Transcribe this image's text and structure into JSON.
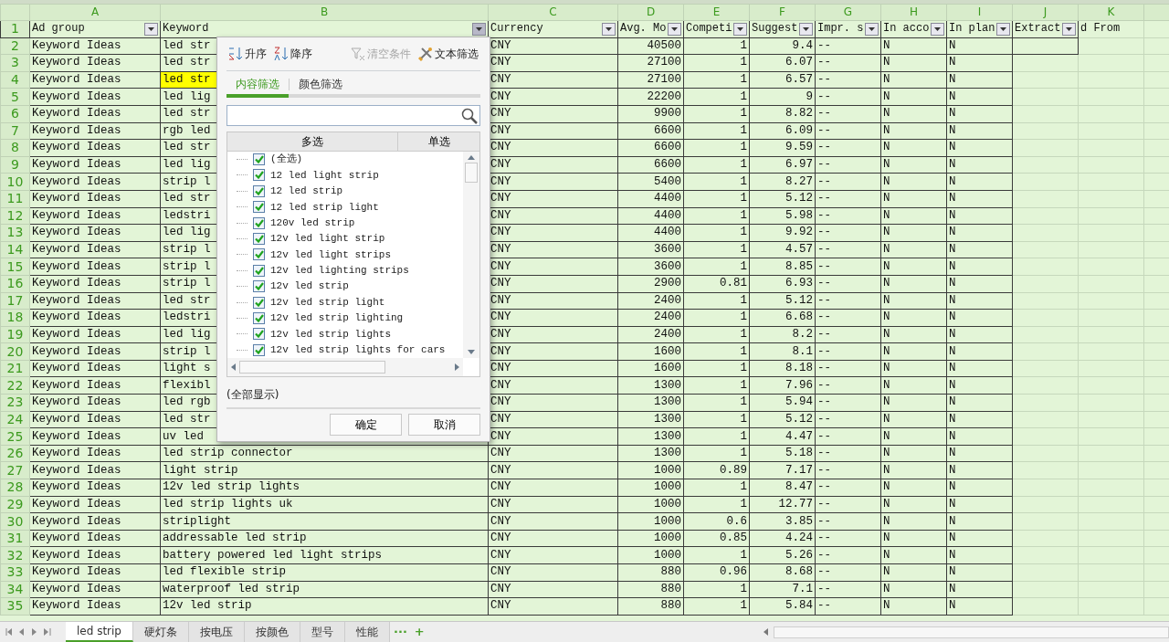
{
  "header_row_number": "1",
  "columns": [
    {
      "letter": "A",
      "header": "Ad group",
      "filter": true,
      "numeric": false,
      "open": false
    },
    {
      "letter": "B",
      "header": "Keyword",
      "filter": true,
      "numeric": false,
      "open": true
    },
    {
      "letter": "C",
      "header": "Currency",
      "filter": true,
      "numeric": false,
      "open": false
    },
    {
      "letter": "D",
      "header": "Avg. Mo",
      "filter": true,
      "numeric": true,
      "open": false
    },
    {
      "letter": "E",
      "header": "Competi",
      "filter": true,
      "numeric": true,
      "open": false
    },
    {
      "letter": "F",
      "header": "Suggest",
      "filter": true,
      "numeric": true,
      "open": false
    },
    {
      "letter": "G",
      "header": "Impr. s",
      "filter": true,
      "numeric": false,
      "open": false
    },
    {
      "letter": "H",
      "header": "In acco",
      "filter": true,
      "numeric": false,
      "open": false
    },
    {
      "letter": "I",
      "header": "In plan",
      "filter": true,
      "numeric": false,
      "open": false
    },
    {
      "letter": "J",
      "header": "Extract",
      "filter": true,
      "numeric": false,
      "open": false
    },
    {
      "letter": "K",
      "header": "d From",
      "filter": false
    }
  ],
  "rows": [
    {
      "number": "2",
      "cells": [
        "Keyword Ideas",
        "led str",
        "CNY",
        "40500",
        "1",
        "9.4",
        "--",
        "N",
        "N"
      ],
      "highlighted": false
    },
    {
      "number": "3",
      "cells": [
        "Keyword Ideas",
        "led str",
        "CNY",
        "27100",
        "1",
        "6.07",
        "--",
        "N",
        "N"
      ],
      "highlighted": false
    },
    {
      "number": "4",
      "cells": [
        "Keyword Ideas",
        "led str",
        "CNY",
        "27100",
        "1",
        "6.57",
        "--",
        "N",
        "N"
      ],
      "highlighted": true
    },
    {
      "number": "5",
      "cells": [
        "Keyword Ideas",
        "led lig",
        "CNY",
        "22200",
        "1",
        "9",
        "--",
        "N",
        "N"
      ],
      "highlighted": false
    },
    {
      "number": "6",
      "cells": [
        "Keyword Ideas",
        "led str",
        "CNY",
        "9900",
        "1",
        "8.82",
        "--",
        "N",
        "N"
      ],
      "highlighted": false
    },
    {
      "number": "7",
      "cells": [
        "Keyword Ideas",
        "rgb led",
        "CNY",
        "6600",
        "1",
        "6.09",
        "--",
        "N",
        "N"
      ],
      "highlighted": false
    },
    {
      "number": "8",
      "cells": [
        "Keyword Ideas",
        "led str",
        "CNY",
        "6600",
        "1",
        "9.59",
        "--",
        "N",
        "N"
      ],
      "highlighted": false
    },
    {
      "number": "9",
      "cells": [
        "Keyword Ideas",
        "led lig",
        "CNY",
        "6600",
        "1",
        "6.97",
        "--",
        "N",
        "N"
      ],
      "highlighted": false
    },
    {
      "number": "10",
      "cells": [
        "Keyword Ideas",
        "strip l",
        "CNY",
        "5400",
        "1",
        "8.27",
        "--",
        "N",
        "N"
      ],
      "highlighted": false
    },
    {
      "number": "11",
      "cells": [
        "Keyword Ideas",
        "led str",
        "CNY",
        "4400",
        "1",
        "5.12",
        "--",
        "N",
        "N"
      ],
      "highlighted": false
    },
    {
      "number": "12",
      "cells": [
        "Keyword Ideas",
        "ledstri",
        "CNY",
        "4400",
        "1",
        "5.98",
        "--",
        "N",
        "N"
      ],
      "highlighted": false
    },
    {
      "number": "13",
      "cells": [
        "Keyword Ideas",
        "led lig",
        "CNY",
        "4400",
        "1",
        "9.92",
        "--",
        "N",
        "N"
      ],
      "highlighted": false
    },
    {
      "number": "14",
      "cells": [
        "Keyword Ideas",
        "strip l",
        "CNY",
        "3600",
        "1",
        "4.57",
        "--",
        "N",
        "N"
      ],
      "highlighted": false
    },
    {
      "number": "15",
      "cells": [
        "Keyword Ideas",
        "strip l",
        "CNY",
        "3600",
        "1",
        "8.85",
        "--",
        "N",
        "N"
      ],
      "highlighted": false
    },
    {
      "number": "16",
      "cells": [
        "Keyword Ideas",
        "strip l",
        "CNY",
        "2900",
        "0.81",
        "6.93",
        "--",
        "N",
        "N"
      ],
      "highlighted": false
    },
    {
      "number": "17",
      "cells": [
        "Keyword Ideas",
        "led str",
        "CNY",
        "2400",
        "1",
        "5.12",
        "--",
        "N",
        "N"
      ],
      "highlighted": false
    },
    {
      "number": "18",
      "cells": [
        "Keyword Ideas",
        "ledstri",
        "CNY",
        "2400",
        "1",
        "6.68",
        "--",
        "N",
        "N"
      ],
      "highlighted": false
    },
    {
      "number": "19",
      "cells": [
        "Keyword Ideas",
        "led lig",
        "CNY",
        "2400",
        "1",
        "8.2",
        "--",
        "N",
        "N"
      ],
      "highlighted": false
    },
    {
      "number": "20",
      "cells": [
        "Keyword Ideas",
        "strip l",
        "CNY",
        "1600",
        "1",
        "8.1",
        "--",
        "N",
        "N"
      ],
      "highlighted": false
    },
    {
      "number": "21",
      "cells": [
        "Keyword Ideas",
        "light s",
        "CNY",
        "1600",
        "1",
        "8.18",
        "--",
        "N",
        "N"
      ],
      "highlighted": false
    },
    {
      "number": "22",
      "cells": [
        "Keyword Ideas",
        "flexibl",
        "CNY",
        "1300",
        "1",
        "7.96",
        "--",
        "N",
        "N"
      ],
      "highlighted": false
    },
    {
      "number": "23",
      "cells": [
        "Keyword Ideas",
        "led rgb",
        "CNY",
        "1300",
        "1",
        "5.94",
        "--",
        "N",
        "N"
      ],
      "highlighted": false
    },
    {
      "number": "24",
      "cells": [
        "Keyword Ideas",
        "led str",
        "CNY",
        "1300",
        "1",
        "5.12",
        "--",
        "N",
        "N"
      ],
      "highlighted": false
    },
    {
      "number": "25",
      "cells": [
        "Keyword Ideas",
        "uv led",
        "CNY",
        "1300",
        "1",
        "4.47",
        "--",
        "N",
        "N"
      ],
      "highlighted": false
    },
    {
      "number": "26",
      "cells": [
        "Keyword Ideas",
        "led strip connector",
        "CNY",
        "1300",
        "1",
        "5.18",
        "--",
        "N",
        "N"
      ],
      "highlighted": false
    },
    {
      "number": "27",
      "cells": [
        "Keyword Ideas",
        "light strip",
        "CNY",
        "1000",
        "0.89",
        "7.17",
        "--",
        "N",
        "N"
      ],
      "highlighted": false
    },
    {
      "number": "28",
      "cells": [
        "Keyword Ideas",
        "12v led strip lights",
        "CNY",
        "1000",
        "1",
        "8.47",
        "--",
        "N",
        "N"
      ],
      "highlighted": false
    },
    {
      "number": "29",
      "cells": [
        "Keyword Ideas",
        "led strip lights uk",
        "CNY",
        "1000",
        "1",
        "12.77",
        "--",
        "N",
        "N"
      ],
      "highlighted": false
    },
    {
      "number": "30",
      "cells": [
        "Keyword Ideas",
        "striplight",
        "CNY",
        "1000",
        "0.6",
        "3.85",
        "--",
        "N",
        "N"
      ],
      "highlighted": false
    },
    {
      "number": "31",
      "cells": [
        "Keyword Ideas",
        "addressable led strip",
        "CNY",
        "1000",
        "0.85",
        "4.24",
        "--",
        "N",
        "N"
      ],
      "highlighted": false
    },
    {
      "number": "32",
      "cells": [
        "Keyword Ideas",
        "battery powered led light strips",
        "CNY",
        "1000",
        "1",
        "5.26",
        "--",
        "N",
        "N"
      ],
      "highlighted": false
    },
    {
      "number": "33",
      "cells": [
        "Keyword Ideas",
        "led flexible strip",
        "CNY",
        "880",
        "0.96",
        "8.68",
        "--",
        "N",
        "N"
      ],
      "highlighted": false
    },
    {
      "number": "34",
      "cells": [
        "Keyword Ideas",
        "waterproof led strip",
        "CNY",
        "880",
        "1",
        "7.1",
        "--",
        "N",
        "N"
      ],
      "highlighted": false
    },
    {
      "number": "35",
      "cells": [
        "Keyword Ideas",
        "12v led strip",
        "CNY",
        "880",
        "1",
        "5.84",
        "--",
        "N",
        "N"
      ],
      "highlighted": false
    }
  ],
  "filter_popup": {
    "actions": [
      {
        "label": "升序",
        "kind": "asc",
        "disabled": false
      },
      {
        "label": "降序",
        "kind": "desc",
        "disabled": false
      },
      {
        "label": "清空条件",
        "kind": "clear",
        "disabled": true
      },
      {
        "label": "文本筛选",
        "kind": "text",
        "disabled": false
      }
    ],
    "tabs": [
      {
        "label": "内容筛选",
        "selected": true
      },
      {
        "label": "颜色筛选",
        "selected": false
      }
    ],
    "modes": [
      "多选",
      "单选"
    ],
    "items": [
      {
        "label": "(全选)",
        "checked": true
      },
      {
        "label": "12 led light strip",
        "checked": true
      },
      {
        "label": "12 led strip",
        "checked": true
      },
      {
        "label": "12 led strip light",
        "checked": true
      },
      {
        "label": "120v led strip",
        "checked": true
      },
      {
        "label": "12v led light strip",
        "checked": true
      },
      {
        "label": "12v led light strips",
        "checked": true
      },
      {
        "label": "12v led lighting strips",
        "checked": true
      },
      {
        "label": "12v led strip",
        "checked": true
      },
      {
        "label": "12v led strip light",
        "checked": true
      },
      {
        "label": "12v led strip lighting",
        "checked": true
      },
      {
        "label": "12v led strip lights",
        "checked": true
      },
      {
        "label": "12v led strip lights for cars",
        "checked": true
      }
    ],
    "note": "(全部显示)",
    "buttons": [
      "确定",
      "取消"
    ]
  },
  "sheet_tabs": [
    {
      "label": "led strip",
      "selected": true
    },
    {
      "label": "硬灯条",
      "selected": false
    },
    {
      "label": "按电压",
      "selected": false
    },
    {
      "label": "按颜色",
      "selected": false
    },
    {
      "label": "型号",
      "selected": false
    },
    {
      "label": "性能",
      "selected": false
    }
  ],
  "more": "···",
  "add": "+"
}
